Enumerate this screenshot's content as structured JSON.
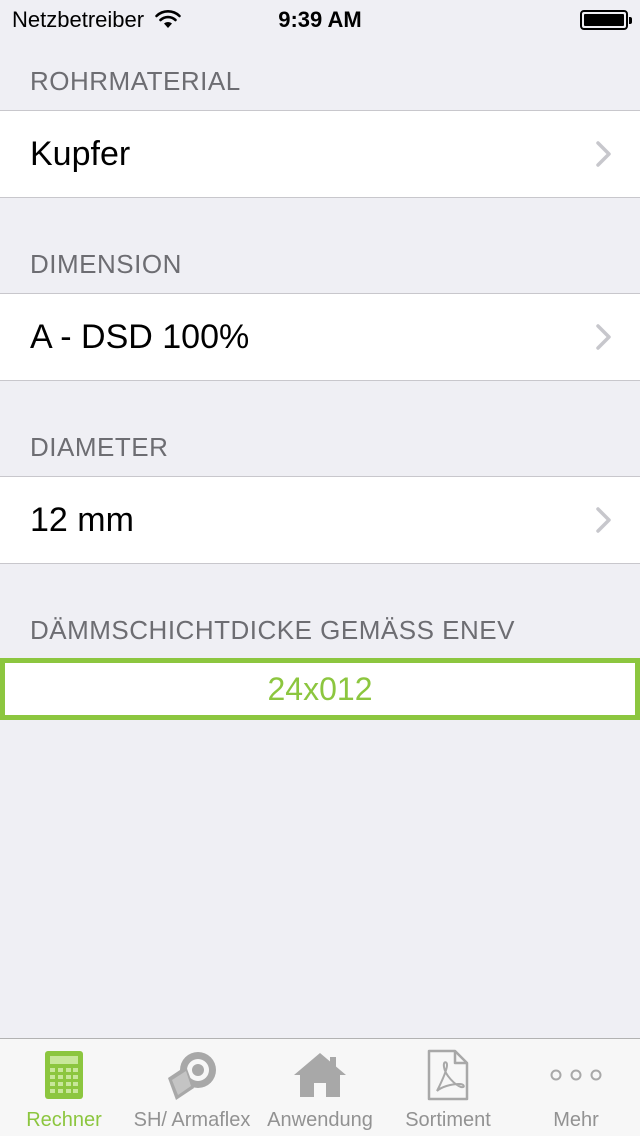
{
  "status_bar": {
    "carrier": "Netzbetreiber",
    "time": "9:39 AM"
  },
  "sections": [
    {
      "header": "ROHRMATERIAL",
      "value": "Kupfer"
    },
    {
      "header": "DIMENSION",
      "value": "A - DSD 100%"
    },
    {
      "header": "DIAMETER",
      "value": "12 mm"
    }
  ],
  "result": {
    "header": "DÄMMSCHICHTDICKE GEMÄSS ENEV",
    "value": "24x012"
  },
  "tabs": [
    {
      "label": "Rechner",
      "icon": "calculator-icon",
      "active": true
    },
    {
      "label": "SH/ Armaflex",
      "icon": "pipe-insulation-icon",
      "active": false
    },
    {
      "label": "Anwendung",
      "icon": "house-icon",
      "active": false
    },
    {
      "label": "Sortiment",
      "icon": "pdf-document-icon",
      "active": false
    },
    {
      "label": "Mehr",
      "icon": "more-icon",
      "active": false
    }
  ],
  "colors": {
    "accent": "#8cc63f",
    "background": "#efeff4",
    "header_text": "#6d6d72",
    "inactive_tab": "#929292"
  }
}
